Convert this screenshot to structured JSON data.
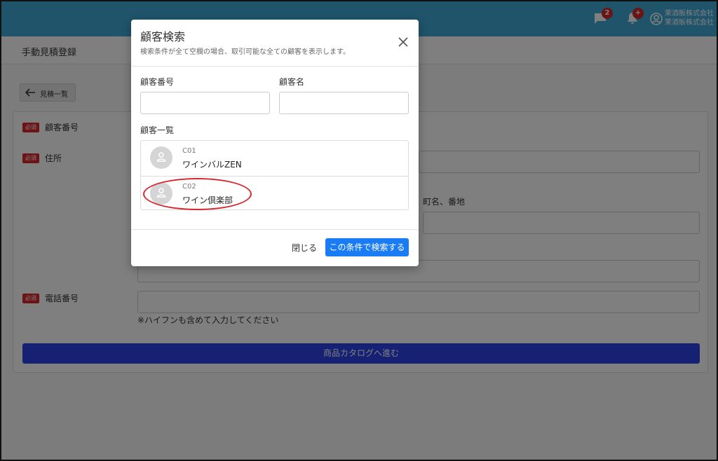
{
  "header": {
    "chat_badge": "2",
    "bell_badge": "+",
    "company_line1": "茉酒販株式会社",
    "company_line2": "茉酒販株式会社"
  },
  "page": {
    "title": "手動見積登録",
    "back_label": "見積一覧"
  },
  "form": {
    "required_tag": "必須",
    "customer_number_label": "顧客番号",
    "address_label": "住所",
    "town_label": "町名、番地",
    "phone_label": "電話番号",
    "phone_hint": "※ハイフンも含めて入力してください",
    "submit_label": "商品カタログへ進む"
  },
  "modal": {
    "title": "顧客検索",
    "subtitle": "検索条件が全て空欄の場合、取引可能な全ての顧客を表示します。",
    "number_label": "顧客番号",
    "name_label": "顧客名",
    "list_label": "顧客一覧",
    "customers": [
      {
        "code": "C01",
        "name": "ワインバルZEN"
      },
      {
        "code": "C02",
        "name": "ワイン倶楽部"
      }
    ],
    "close_label": "閉じる",
    "search_label": "この条件で検索する"
  }
}
